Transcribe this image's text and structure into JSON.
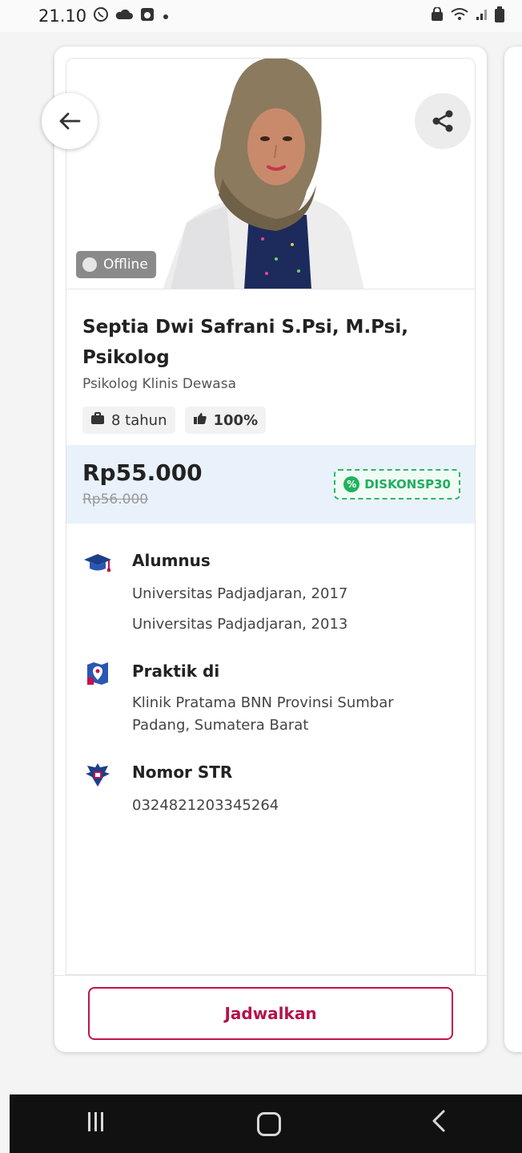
{
  "status_bar": {
    "time": "21.10",
    "icons_left": [
      "whatsapp-icon",
      "cloud-icon",
      "app-notification-icon",
      "dot-icon"
    ],
    "icons_right": [
      "screenshot-lock-icon",
      "wifi-icon",
      "signal-icon",
      "battery-icon"
    ]
  },
  "profile": {
    "status": "Offline",
    "name": "Septia Dwi Safrani S.Psi, M.Psi, Psikolog",
    "specialty": "Psikolog Klinis Dewasa",
    "experience": "8 tahun",
    "rating": "100%"
  },
  "pricing": {
    "current": "Rp55.000",
    "original": "Rp56.000",
    "coupon": "DISKONSP30"
  },
  "sections": {
    "alumnus": {
      "title": "Alumnus",
      "lines": [
        "Universitas Padjadjaran, 2017",
        "Universitas Padjadjaran, 2013"
      ]
    },
    "practice": {
      "title": "Praktik di",
      "lines": [
        "Klinik Pratama BNN Provinsi Sumbar",
        "Padang, Sumatera Barat"
      ]
    },
    "str": {
      "title": "Nomor STR",
      "lines": [
        "0324821203345264"
      ]
    }
  },
  "actions": {
    "schedule": "Jadwalkan"
  },
  "colors": {
    "accent": "#c0134e",
    "coupon_green": "#21b260",
    "price_bg": "#e9f1fb",
    "offline_badge": "#8a8a8a"
  }
}
